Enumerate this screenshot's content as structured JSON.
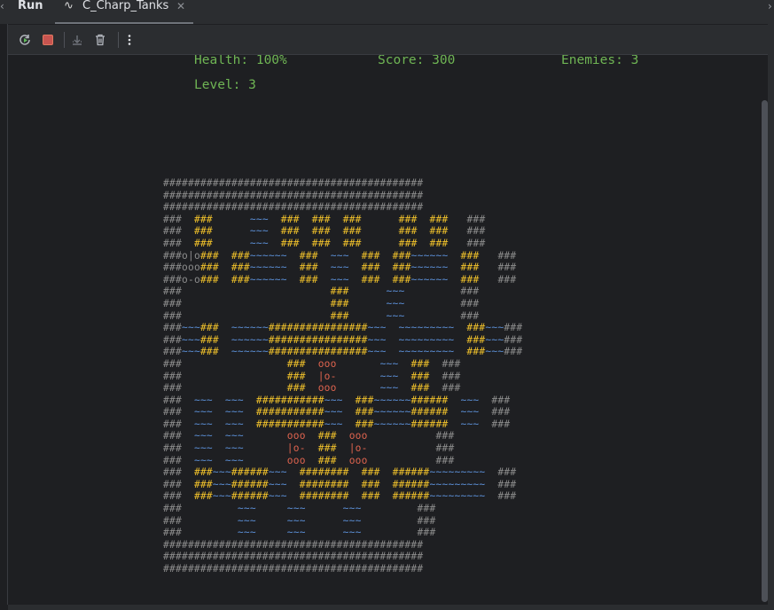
{
  "tabs": {
    "run_label": "Run",
    "active_tab_label": "C_Charp_Tanks"
  },
  "toolbar": {
    "rerun": "rerun-icon",
    "stop": "stop-icon",
    "scroll_to_end": "scroll-to-end-icon",
    "clear": "trash-icon",
    "more": "more-vertical-icon"
  },
  "game": {
    "health": "Health: 100%",
    "score": "Score: 300",
    "enemies": "Enemies: 3",
    "level": "Level: 3"
  },
  "legend": {
    "wall_char": "#",
    "water_char": "~",
    "colors": {
      "border": "#8c8c8c",
      "wall": "#f0c12b",
      "water": "#5b8fd6",
      "enemy": "#e0644f",
      "text": "#6fb554"
    }
  },
  "map": {
    "rows": [
      "##########################################",
      "##########################################",
      "##########################################",
      "###  ###      ~~~  ###  ###  ###      ###  ###   ###",
      "###  ###      ~~~  ###  ###  ###      ###  ###   ###",
      "###  ###      ~~~  ###  ###  ###      ###  ###   ###",
      "###o|o###  ###~~~~~~  ###  ~~~  ###  ###~~~~~~  ###   ###",
      "###ooo###  ###~~~~~~  ###  ~~~  ###  ###~~~~~~  ###   ###",
      "###o-o###  ###~~~~~~  ###  ~~~  ###  ###~~~~~~  ###   ###",
      "###                        ###      ~~~         ###",
      "###                        ###      ~~~         ###",
      "###                        ###      ~~~         ###",
      "###~~~###  ~~~~~~################~~~  ~~~~~~~~~  ###~~~###",
      "###~~~###  ~~~~~~################~~~  ~~~~~~~~~  ###~~~###",
      "###~~~###  ~~~~~~################~~~  ~~~~~~~~~  ###~~~###",
      "###                 ###  ooo       ~~~  ###  ###",
      "###                 ###  |o-       ~~~  ###  ###",
      "###                 ###  ooo       ~~~  ###  ###",
      "###  ~~~  ~~~  ###########~~~  ###~~~~~~######  ~~~  ###",
      "###  ~~~  ~~~  ###########~~~  ###~~~~~~######  ~~~  ###",
      "###  ~~~  ~~~  ###########~~~  ###~~~~~~######  ~~~  ###",
      "###  ~~~  ~~~       ooo  ###  ooo           ###",
      "###  ~~~  ~~~       |o-  ###  |o-           ###",
      "###  ~~~  ~~~       ooo  ###  ooo           ###",
      "###  ###~~~######~~~  ########  ###  ######~~~~~~~~~  ###",
      "###  ###~~~######~~~  ########  ###  ######~~~~~~~~~  ###",
      "###  ###~~~######~~~  ########  ###  ######~~~~~~~~~  ###",
      "###         ~~~     ~~~      ~~~         ###",
      "###         ~~~     ~~~      ~~~         ###",
      "###         ~~~     ~~~      ~~~         ###",
      "##########################################",
      "##########################################",
      "##########################################"
    ]
  }
}
